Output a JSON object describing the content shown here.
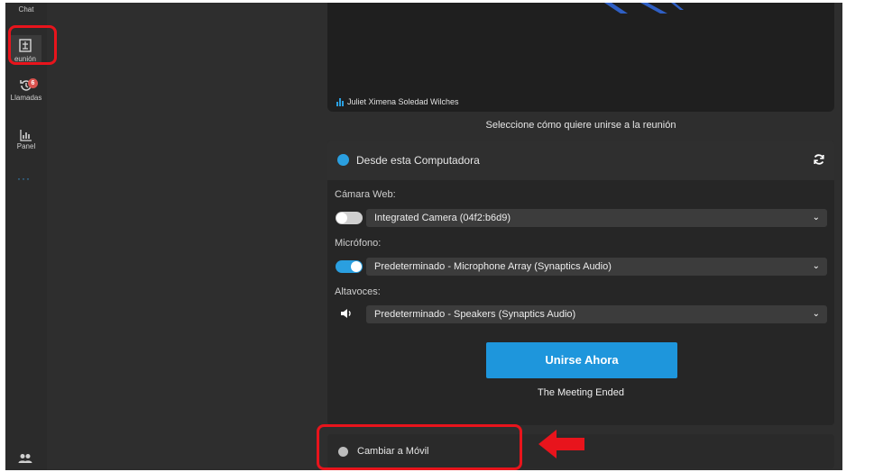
{
  "rail": {
    "chat_label": "Chat",
    "meeting_label": "eunión",
    "calls_label": "Llamadas",
    "calls_badge": "6",
    "panel_label": "Panel",
    "more_label": "···"
  },
  "video": {
    "speaker_name": "Juliet Ximena Soledad Wilches"
  },
  "join_heading": "Seleccione cómo quiere unirse a la reunión",
  "computer_option": {
    "title": "Desde esta Computadora",
    "camera_label": "Cámara Web:",
    "camera_value": "Integrated Camera (04f2:b6d9)",
    "camera_enabled": false,
    "mic_label": "Micrófono:",
    "mic_value": "Predeterminado - Microphone Array (Synaptics Audio)",
    "mic_enabled": true,
    "speakers_label": "Altavoces:",
    "speakers_value": "Predeterminado - Speakers (Synaptics Audio)",
    "join_button": "Unirse Ahora",
    "status": "The Meeting Ended"
  },
  "mobile_option": {
    "label": "Cambiar a Móvil"
  },
  "colors": {
    "accent": "#1e96dc",
    "highlight": "#e8141c",
    "background": "#2e2e2e"
  }
}
